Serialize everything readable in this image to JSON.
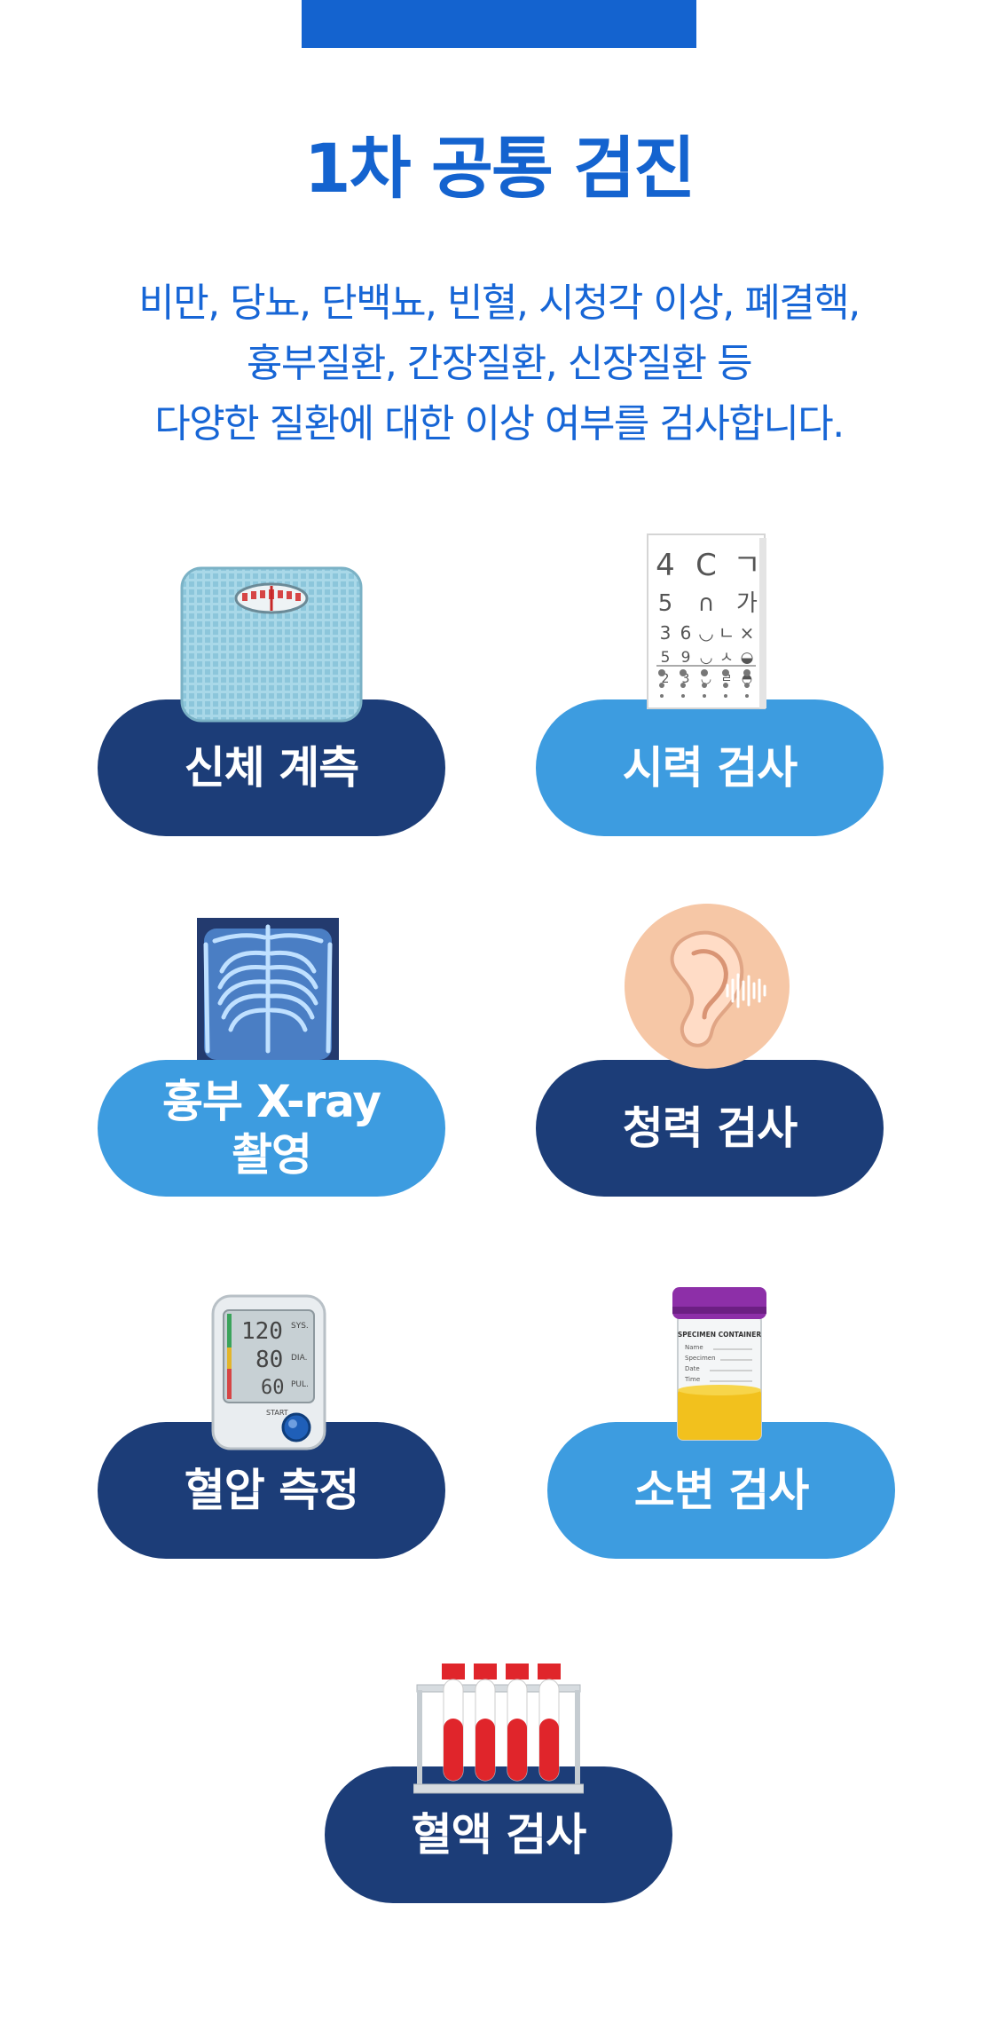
{
  "title": "1차 공통 검진",
  "description": [
    "비만, 당뇨, 단백뇨, 빈혈, 시청각 이상, 폐결핵,",
    "흉부질환, 간장질환, 신장질환 등",
    "다양한 질환에 대한 이상 여부를 검사합니다."
  ],
  "items": {
    "body_measure": {
      "label": "신체 계측",
      "icon": "scale-icon"
    },
    "vision": {
      "label": "시력 검사",
      "icon": "eye-chart-icon",
      "chart_rows": [
        [
          "4",
          "C",
          "ㄱ"
        ],
        [
          "5",
          "∩",
          "가"
        ],
        [
          "3",
          "6",
          "◡",
          "ㄴ",
          "×"
        ],
        [
          "5",
          "9",
          "◡",
          "ㅅ",
          "◒"
        ],
        [
          "2",
          "3",
          "◡",
          "ㄹ",
          "◓"
        ]
      ]
    },
    "xray": {
      "label_line1": "흉부 X-ray",
      "label_line2": "촬영",
      "icon": "chest-xray-icon"
    },
    "hearing": {
      "label": "청력 검사",
      "icon": "ear-icon"
    },
    "blood_pressure": {
      "label": "혈압 측정",
      "icon": "blood-pressure-monitor-icon",
      "sys": "120",
      "dia": "80",
      "pul": "60",
      "sys_label": "SYS.",
      "dia_label": "DIA.",
      "pul_label": "PUL.",
      "start": "START"
    },
    "urine": {
      "label": "소변 검사",
      "icon": "specimen-container-icon",
      "container_title": "SPECIMEN CONTAINER",
      "fields": [
        "Name",
        "Specimen",
        "Date",
        "Time"
      ]
    },
    "blood": {
      "label": "혈액  검사",
      "icon": "blood-test-tubes-icon"
    }
  },
  "colors": {
    "title": "#1463cf",
    "description": "#1766d6",
    "pill_dark": "#1c3d78",
    "pill_light": "#3d9ce0",
    "top_bar": "#1463cf"
  }
}
